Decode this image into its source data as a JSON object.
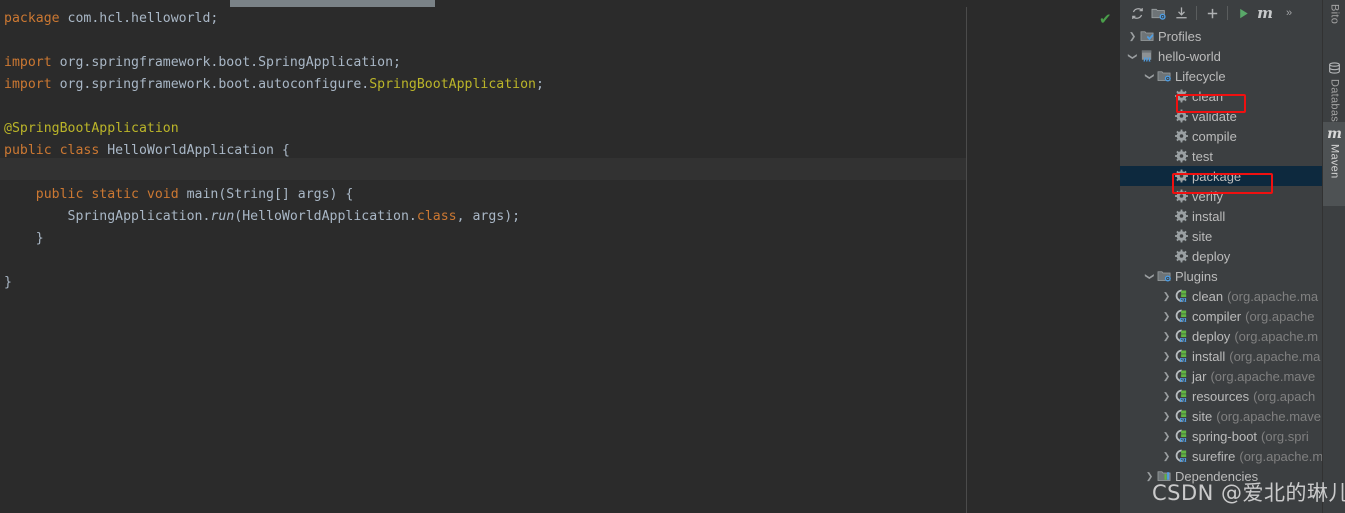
{
  "editor": {
    "code_lines": [
      {
        "segs": [
          {
            "t": "package",
            "c": "kw"
          },
          {
            "t": " com.hcl.helloworld;",
            "c": "idn"
          }
        ]
      },
      {
        "segs": []
      },
      {
        "segs": [
          {
            "t": "import",
            "c": "kw"
          },
          {
            "t": " org.springframework.boot.SpringApplication;",
            "c": "idn"
          }
        ]
      },
      {
        "segs": [
          {
            "t": "import",
            "c": "kw"
          },
          {
            "t": " org.springframework.boot.autoconfigure.",
            "c": "idn"
          },
          {
            "t": "SpringBootApplication",
            "c": "yel"
          },
          {
            "t": ";",
            "c": "idn"
          }
        ]
      },
      {
        "segs": []
      },
      {
        "segs": [
          {
            "t": "@SpringBootApplication",
            "c": "ann"
          }
        ]
      },
      {
        "segs": [
          {
            "t": "public class",
            "c": "kw"
          },
          {
            "t": " HelloWorldApplication {",
            "c": "idn"
          }
        ]
      },
      {
        "segs": []
      },
      {
        "segs": [
          {
            "t": "    public static void",
            "c": "kw"
          },
          {
            "t": " main(String[] args) {",
            "c": "idn"
          }
        ]
      },
      {
        "segs": [
          {
            "t": "        SpringApplication.",
            "c": "idn"
          },
          {
            "t": "run",
            "c": "ital"
          },
          {
            "t": "(HelloWorldApplication.",
            "c": "idn"
          },
          {
            "t": "class",
            "c": "kw"
          },
          {
            "t": ", args);",
            "c": "idn"
          }
        ]
      },
      {
        "segs": [
          {
            "t": "    }",
            "c": "idn"
          }
        ]
      },
      {
        "segs": []
      },
      {
        "segs": [
          {
            "t": "}",
            "c": "idn"
          }
        ]
      }
    ],
    "inspection_icon": "✔",
    "inspection_status": "no-problems-check"
  },
  "maven": {
    "toolbar": [
      {
        "name": "reload-all-maven-projects-icon",
        "glyph": "refresh"
      },
      {
        "name": "generate-sources-icon",
        "glyph": "folder-gear"
      },
      {
        "name": "download-sources-icon",
        "glyph": "download"
      },
      {
        "name": "separator-1",
        "glyph": "sep"
      },
      {
        "name": "add-maven-project-icon",
        "glyph": "plus"
      },
      {
        "name": "separator-2",
        "glyph": "sep"
      },
      {
        "name": "run-maven-build-icon",
        "glyph": "play"
      },
      {
        "name": "execute-maven-goal-icon",
        "glyph": "m"
      },
      {
        "name": "more-options-icon",
        "glyph": "chevrons"
      }
    ],
    "tree": [
      {
        "label": "Profiles",
        "indent": 0,
        "arrow": "right",
        "icon": "profiles-folder",
        "selected": false
      },
      {
        "label": "hello-world",
        "indent": 0,
        "arrow": "down",
        "icon": "maven-project",
        "selected": false
      },
      {
        "label": "Lifecycle",
        "indent": 1,
        "arrow": "down",
        "icon": "lifecycle-folder",
        "selected": false
      },
      {
        "label": "clean",
        "indent": 2,
        "arrow": "none",
        "icon": "goal-gear",
        "selected": false
      },
      {
        "label": "validate",
        "indent": 2,
        "arrow": "none",
        "icon": "goal-gear",
        "selected": false
      },
      {
        "label": "compile",
        "indent": 2,
        "arrow": "none",
        "icon": "goal-gear",
        "selected": false
      },
      {
        "label": "test",
        "indent": 2,
        "arrow": "none",
        "icon": "goal-gear",
        "selected": false
      },
      {
        "label": "package",
        "indent": 2,
        "arrow": "none",
        "icon": "goal-gear",
        "selected": true
      },
      {
        "label": "verify",
        "indent": 2,
        "arrow": "none",
        "icon": "goal-gear",
        "selected": false
      },
      {
        "label": "install",
        "indent": 2,
        "arrow": "none",
        "icon": "goal-gear",
        "selected": false
      },
      {
        "label": "site",
        "indent": 2,
        "arrow": "none",
        "icon": "goal-gear",
        "selected": false
      },
      {
        "label": "deploy",
        "indent": 2,
        "arrow": "none",
        "icon": "goal-gear",
        "selected": false
      },
      {
        "label": "Plugins",
        "indent": 1,
        "arrow": "down",
        "icon": "plugins-folder",
        "selected": false
      },
      {
        "label": "clean",
        "sub": "(org.apache.ma",
        "indent": 2,
        "arrow": "right",
        "icon": "plugin",
        "selected": false
      },
      {
        "label": "compiler",
        "sub": "(org.apache",
        "indent": 2,
        "arrow": "right",
        "icon": "plugin",
        "selected": false
      },
      {
        "label": "deploy",
        "sub": "(org.apache.m",
        "indent": 2,
        "arrow": "right",
        "icon": "plugin",
        "selected": false
      },
      {
        "label": "install",
        "sub": "(org.apache.ma",
        "indent": 2,
        "arrow": "right",
        "icon": "plugin",
        "selected": false
      },
      {
        "label": "jar",
        "sub": "(org.apache.mave",
        "indent": 2,
        "arrow": "right",
        "icon": "plugin",
        "selected": false
      },
      {
        "label": "resources",
        "sub": "(org.apach",
        "indent": 2,
        "arrow": "right",
        "icon": "plugin",
        "selected": false
      },
      {
        "label": "site",
        "sub": "(org.apache.mave",
        "indent": 2,
        "arrow": "right",
        "icon": "plugin",
        "selected": false
      },
      {
        "label": "spring-boot",
        "sub": "(org.spri",
        "indent": 2,
        "arrow": "right",
        "icon": "plugin",
        "selected": false
      },
      {
        "label": "surefire",
        "sub": "(org.apache.m",
        "indent": 2,
        "arrow": "right",
        "icon": "plugin",
        "selected": false
      },
      {
        "label": "Dependencies",
        "indent": 1,
        "arrow": "right",
        "icon": "dependencies-folder",
        "selected": false
      }
    ]
  },
  "right_tool_tabs": [
    {
      "label": "Bito",
      "icon": "bito-icon",
      "active": false
    },
    {
      "label": "Database",
      "icon": "database-icon",
      "active": false
    },
    {
      "label": "Maven",
      "icon": "maven-m-icon",
      "active": true
    }
  ],
  "annotations": {
    "box_clean_label": "clean",
    "box_package_label": "package"
  },
  "watermark": {
    "text": "CSDN @爱北的琳儿"
  },
  "colors": {
    "editor_bg": "#2b2b2b",
    "panel_bg": "#3c3f41",
    "selection_bg": "#0d293e",
    "keyword": "#cc7832",
    "annotation": "#bbb529",
    "identifier": "#a9b7c6",
    "accent_red": "#f01010",
    "run_green": "#4a9e4a"
  }
}
